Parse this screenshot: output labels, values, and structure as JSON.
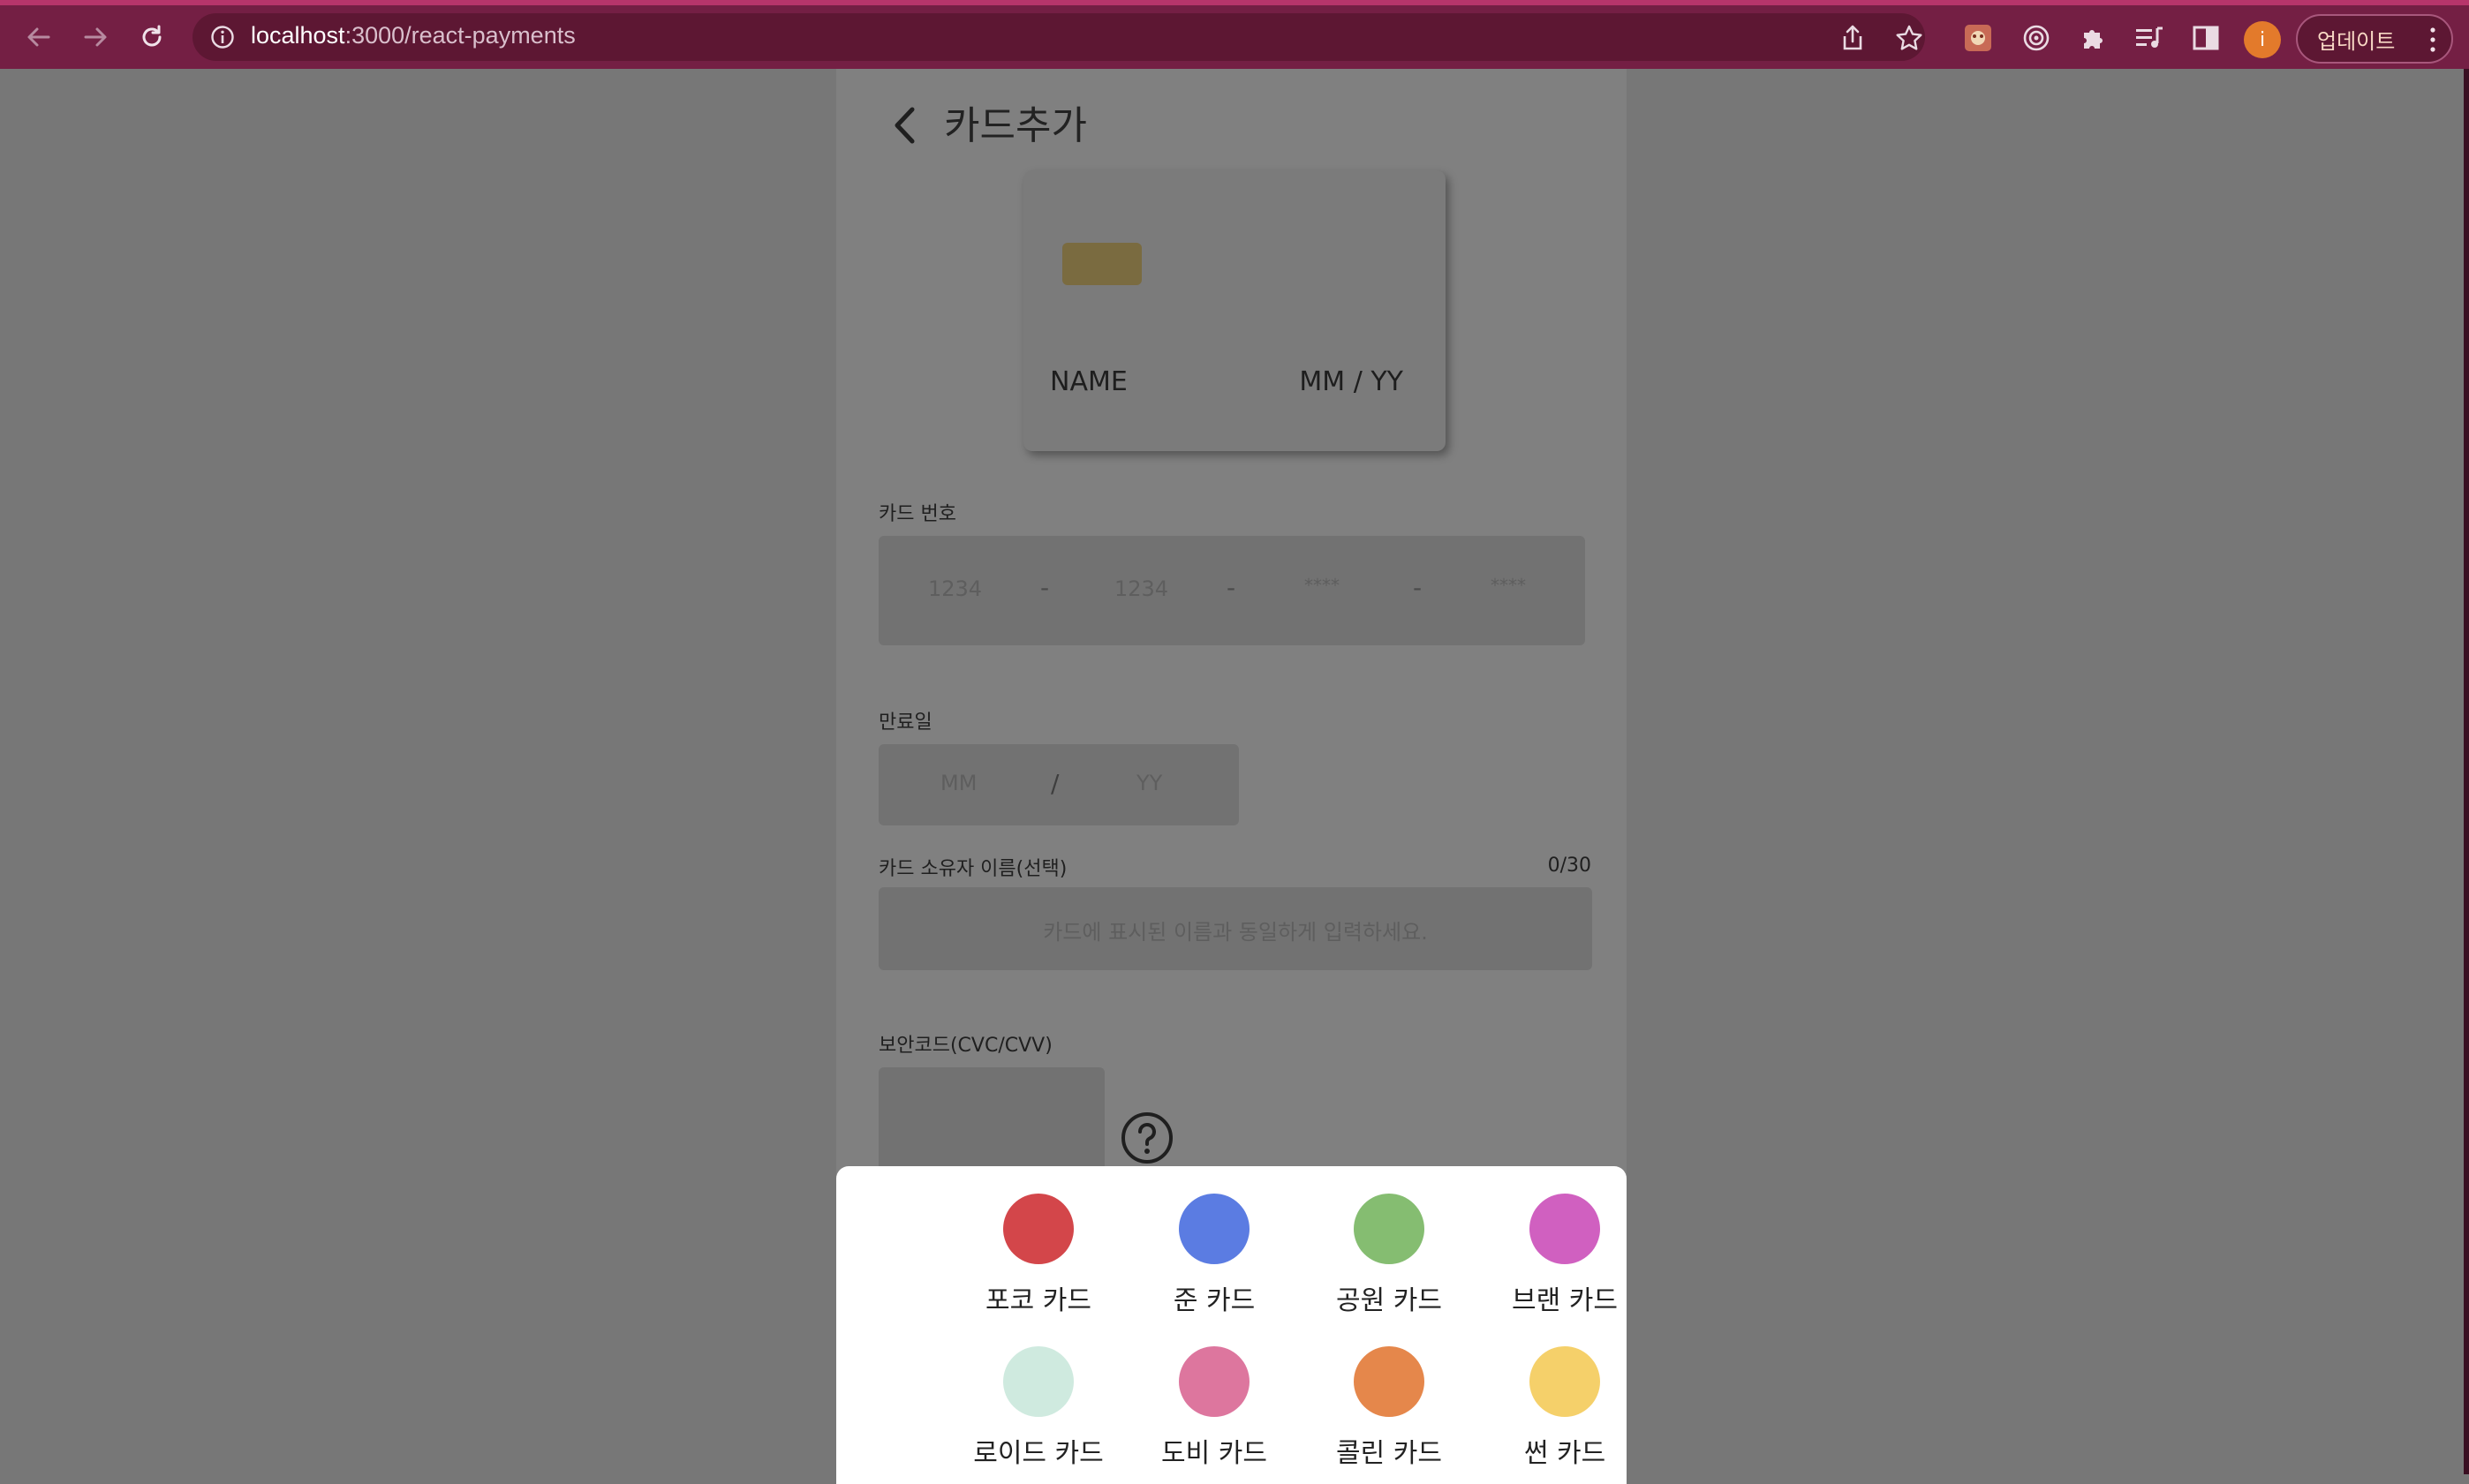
{
  "browser": {
    "url_host": "localhost",
    "url_path": ":3000/react-payments",
    "profile_initial": "i",
    "update_label": "업데이트"
  },
  "page": {
    "title": "카드추가",
    "card_preview": {
      "name": "NAME",
      "expiry": "MM / YY",
      "chip_color": "#7a6b40"
    },
    "card_number": {
      "label": "카드 번호",
      "placeholders": [
        "1234",
        "1234",
        "****",
        "****"
      ],
      "separator": "-"
    },
    "expiry": {
      "label": "만료일",
      "month_placeholder": "MM",
      "year_placeholder": "YY",
      "separator": "/"
    },
    "owner": {
      "label": "카드 소유자 이름(선택)",
      "counter": "0/30",
      "placeholder": "카드에 표시된 이름과 동일하게 입력하세요."
    },
    "cvc": {
      "label": "보안코드(CVC/CVV)",
      "help_icon": "question-circle-icon"
    }
  },
  "card_picker": {
    "options": [
      {
        "name": "포코 카드",
        "color": "#d3464a"
      },
      {
        "name": "준 카드",
        "color": "#5b7ce2"
      },
      {
        "name": "공원 카드",
        "color": "#85bd71"
      },
      {
        "name": "브랜 카드",
        "color": "#d060c0"
      },
      {
        "name": "로이드 카드",
        "color": "#cfeadf"
      },
      {
        "name": "도비 카드",
        "color": "#dd769e"
      },
      {
        "name": "콜린 카드",
        "color": "#e5874b"
      },
      {
        "name": "썬 카드",
        "color": "#f5d06a"
      }
    ]
  }
}
